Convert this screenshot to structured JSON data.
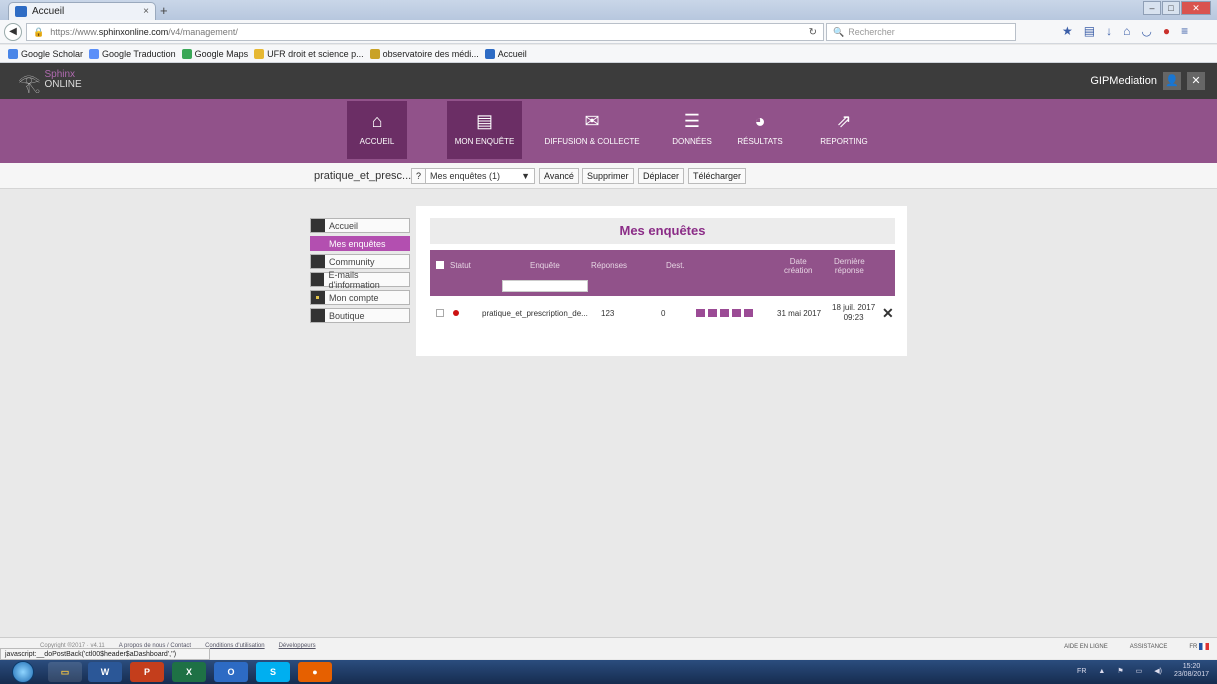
{
  "browser": {
    "tab_title": "Accueil",
    "tab_close": "×",
    "new_tab": "+",
    "url_prefix": "https://www.",
    "url_domain": "sphinxonline.com",
    "url_path": "/v4/management/",
    "search_placeholder": "Rechercher",
    "bookmarks": [
      {
        "label": "Google Scholar",
        "color": "#4a86e8"
      },
      {
        "label": "Google Traduction",
        "color": "#5b8ff9"
      },
      {
        "label": "Google Maps",
        "color": "#3aa757"
      },
      {
        "label": "UFR droit et science p...",
        "color": "#e6b833"
      },
      {
        "label": "observatoire des médi...",
        "color": "#c9a227"
      },
      {
        "label": "Accueil",
        "color": "#2d6bc4"
      }
    ]
  },
  "app": {
    "logo_line1": "Sphinx",
    "logo_line2": "ONLINE",
    "username": "GIPMediation",
    "user_icon": "👤",
    "close_icon": "✕",
    "nav": [
      {
        "label": "ACCUEIL",
        "icon": "home-icon",
        "selected": true
      },
      {
        "label": "MON ENQUÊTE",
        "icon": "document-icon",
        "selected": true
      },
      {
        "label": "DIFFUSION & COLLECTE",
        "icon": "envelope-icon",
        "selected": false
      },
      {
        "label": "DONNÉES",
        "icon": "server-icon",
        "selected": false
      },
      {
        "label": "RÉSULTATS",
        "icon": "pie-chart-icon",
        "selected": false
      },
      {
        "label": "REPORTING",
        "icon": "export-icon",
        "selected": false
      }
    ],
    "accent": "#91528a"
  },
  "toolbar": {
    "project": "pratique_et_presc...",
    "help": "?",
    "select_value": "Mes enquêtes (1)",
    "select_arrow": "▼",
    "avance": "Avancé",
    "supprimer": "Supprimer",
    "deplacer": "Déplacer",
    "telecharger": "Télécharger"
  },
  "leftmenu": [
    {
      "label": "Accueil",
      "selected": false
    },
    {
      "label": "Mes enquêtes",
      "selected": true
    },
    {
      "label": "Community",
      "selected": false
    },
    {
      "label": "E-mails d'information",
      "selected": false
    },
    {
      "label": "Mon compte",
      "selected": false
    },
    {
      "label": "Boutique",
      "selected": false
    }
  ],
  "panel": {
    "title": "Mes enquêtes",
    "headers": {
      "statut": "Statut",
      "enquete": "Enquête",
      "reponses": "Réponses",
      "dest": "Dest.",
      "date_line1": "Date",
      "date_line2": "création",
      "last_line1": "Dernière",
      "last_line2": "réponse"
    },
    "row": {
      "name": "pratique_et_prescription_de...",
      "reponses": "123",
      "dest": "0",
      "date": "31 mai 2017",
      "last_line1": "18 juil. 2017",
      "last_line2": "09:23",
      "delete": "✕"
    }
  },
  "footer": {
    "copyright": "Copyright ®2017 · v4.11",
    "apropos": "A propos de nous / Contact",
    "conditions": "Conditions d'utilisation",
    "dev": "Développeurs",
    "aide": "AIDE EN LIGNE",
    "assistance": "ASSISTANCE",
    "lang": "FR",
    "status": "javascript:__doPostBack('ctl00$header$aDashboard','')"
  },
  "taskbar": {
    "lang": "FR",
    "time": "15:20",
    "date": "23/08/2017"
  }
}
